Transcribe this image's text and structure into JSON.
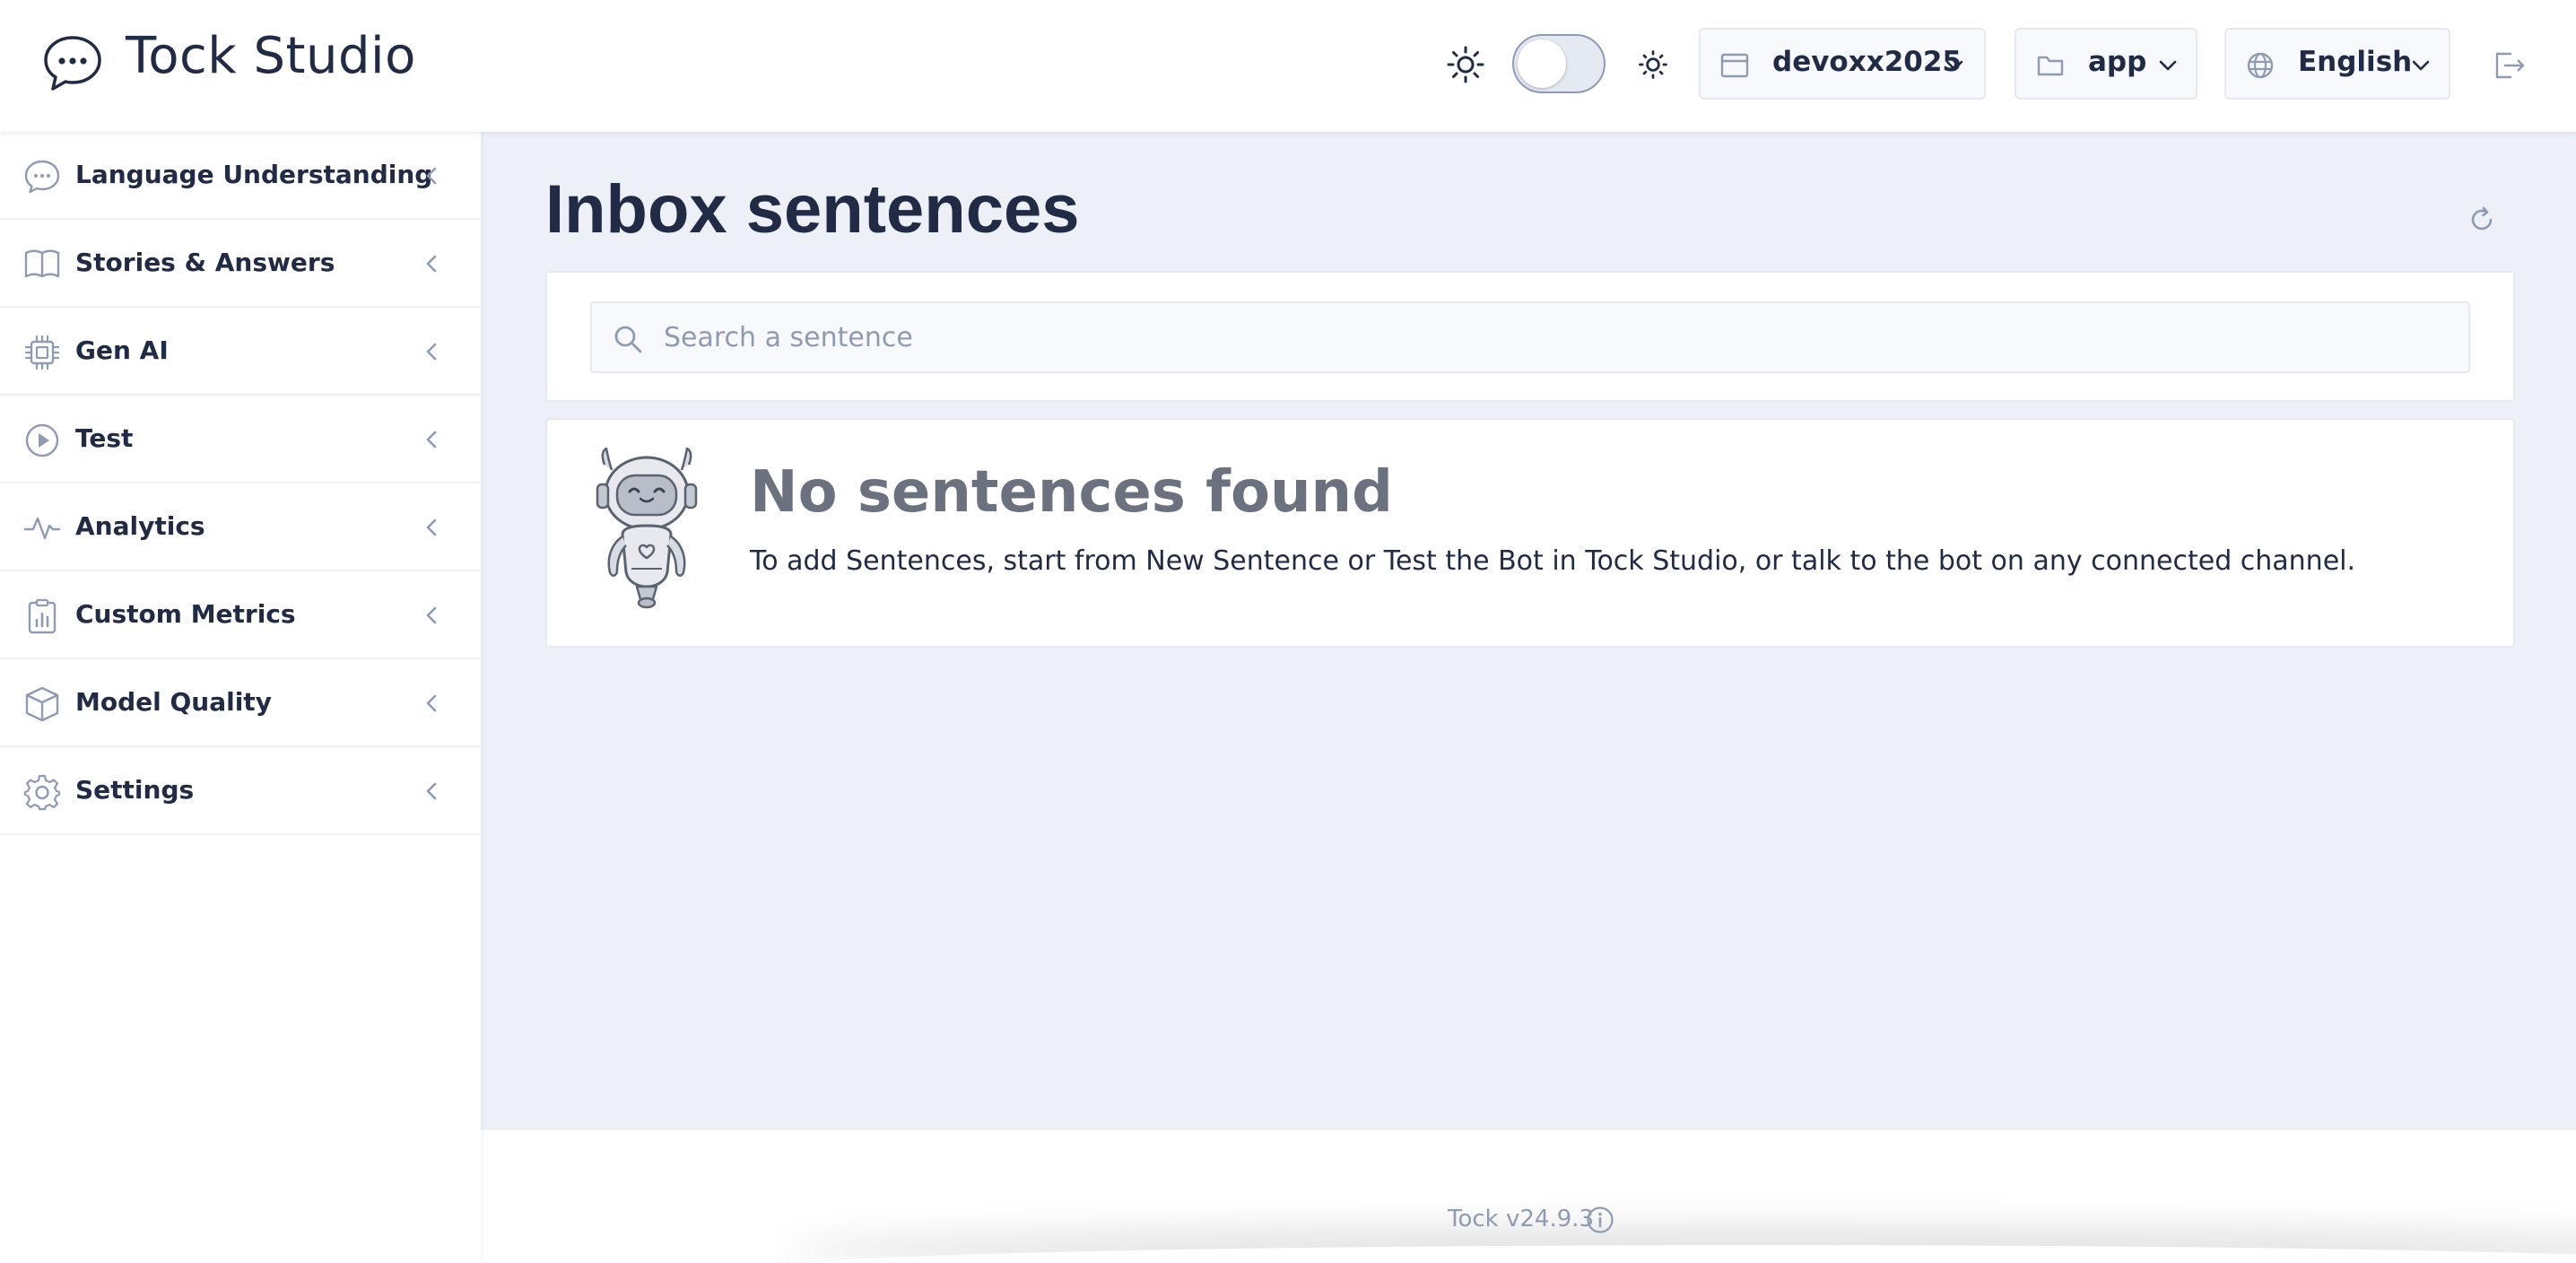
{
  "header": {
    "app_title": "Tock Studio",
    "namespace": "devoxx2025",
    "application": "app",
    "locale": "English"
  },
  "sidebar": {
    "items": [
      {
        "label": "Language Understanding",
        "icon": "chat-dots-icon"
      },
      {
        "label": "Stories & Answers",
        "icon": "book-open-icon"
      },
      {
        "label": "Gen AI",
        "icon": "cpu-icon"
      },
      {
        "label": "Test",
        "icon": "play-circle-icon"
      },
      {
        "label": "Analytics",
        "icon": "activity-icon"
      },
      {
        "label": "Custom Metrics",
        "icon": "clipboard-chart-icon"
      },
      {
        "label": "Model Quality",
        "icon": "cube-icon"
      },
      {
        "label": "Settings",
        "icon": "gear-icon"
      }
    ]
  },
  "main": {
    "page_title": "Inbox sentences",
    "search": {
      "placeholder": "Search a sentence",
      "value": ""
    },
    "empty": {
      "title": "No sentences found",
      "text": "To add Sentences, start from New Sentence or Test the Bot in Tock Studio, or talk to the bot on any connected channel."
    }
  },
  "footer": {
    "version": "Tock v24.9.3"
  },
  "colors": {
    "primary_text": "#222b45",
    "muted_text": "#8f9bb3",
    "background": "#edf1f7",
    "border": "#e4e9f2"
  }
}
